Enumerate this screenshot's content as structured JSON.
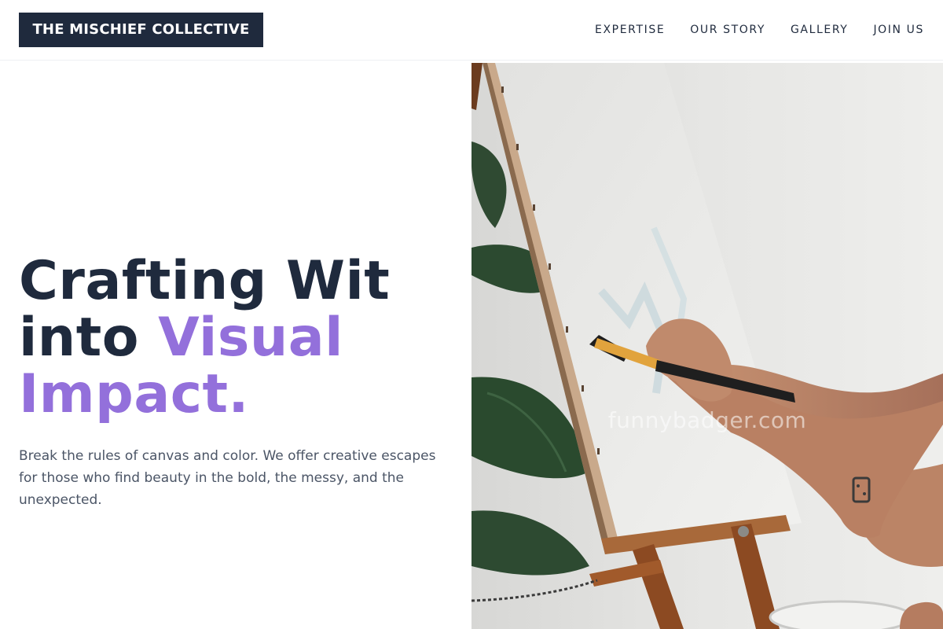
{
  "header": {
    "logo": "THE MISCHIEF COLLECTIVE",
    "nav": [
      {
        "label": "EXPERTISE"
      },
      {
        "label": "OUR STORY"
      },
      {
        "label": "GALLERY"
      },
      {
        "label": "JOIN US"
      }
    ]
  },
  "hero": {
    "title_line1": "Crafting Wit",
    "title_line2_plain": "into ",
    "title_line2_accent": "Visual",
    "title_line3_accent": "Impact.",
    "description": "Break the rules of canvas and color. We offer creative escapes for those who find beauty in the bold, the messy, and the unexpected.",
    "image_watermark": "funnybadger.com"
  },
  "colors": {
    "brand_dark": "#1f2a3d",
    "accent_purple": "#9370db",
    "body_text": "#4b5566"
  }
}
